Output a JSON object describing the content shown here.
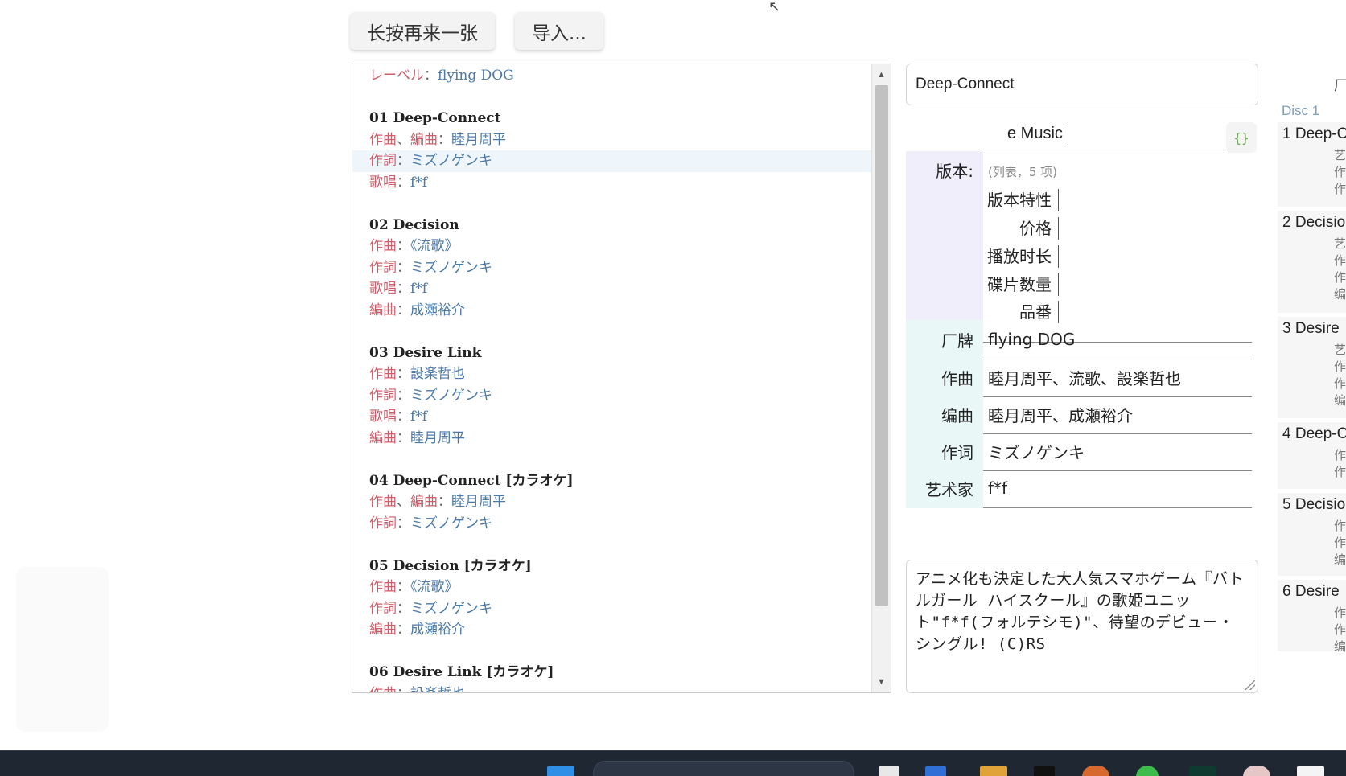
{
  "toolbar": {
    "next_label": "长按再来一张",
    "import_label": "导入..."
  },
  "lyrics": [
    {
      "type": "kv",
      "keys": [
        "レーベル"
      ],
      "value": "flying DOG"
    },
    {
      "type": "blank"
    },
    {
      "type": "title",
      "text": "01 Deep-Connect"
    },
    {
      "type": "kv",
      "keys": [
        "作曲",
        "編曲"
      ],
      "value": "睦月周平"
    },
    {
      "type": "kv",
      "keys": [
        "作詞"
      ],
      "value": "ミズノゲンキ",
      "highlight": true
    },
    {
      "type": "kv",
      "keys": [
        "歌唱"
      ],
      "value": "f*f"
    },
    {
      "type": "blank"
    },
    {
      "type": "title",
      "text": "02 Decision"
    },
    {
      "type": "kv",
      "keys": [
        "作曲"
      ],
      "value": "《流歌》"
    },
    {
      "type": "kv",
      "keys": [
        "作詞"
      ],
      "value": "ミズノゲンキ"
    },
    {
      "type": "kv",
      "keys": [
        "歌唱"
      ],
      "value": "f*f"
    },
    {
      "type": "kv",
      "keys": [
        "編曲"
      ],
      "value": "成瀬裕介"
    },
    {
      "type": "blank"
    },
    {
      "type": "title",
      "text": "03 Desire Link"
    },
    {
      "type": "kv",
      "keys": [
        "作曲"
      ],
      "value": "設楽哲也"
    },
    {
      "type": "kv",
      "keys": [
        "作詞"
      ],
      "value": "ミズノゲンキ"
    },
    {
      "type": "kv",
      "keys": [
        "歌唱"
      ],
      "value": "f*f"
    },
    {
      "type": "kv",
      "keys": [
        "編曲"
      ],
      "value": "睦月周平"
    },
    {
      "type": "blank"
    },
    {
      "type": "title",
      "text": "04 Deep-Connect [カラオケ]"
    },
    {
      "type": "kv",
      "keys": [
        "作曲",
        "編曲"
      ],
      "value": "睦月周平"
    },
    {
      "type": "kv",
      "keys": [
        "作詞"
      ],
      "value": "ミズノゲンキ"
    },
    {
      "type": "blank"
    },
    {
      "type": "title",
      "text": "05 Decision [カラオケ]"
    },
    {
      "type": "kv",
      "keys": [
        "作曲"
      ],
      "value": "《流歌》"
    },
    {
      "type": "kv",
      "keys": [
        "作詞"
      ],
      "value": "ミズノゲンキ"
    },
    {
      "type": "kv",
      "keys": [
        "編曲"
      ],
      "value": "成瀬裕介"
    },
    {
      "type": "blank"
    },
    {
      "type": "title",
      "text": "06 Desire Link [カラオケ]"
    },
    {
      "type": "kv",
      "keys": [
        "作曲"
      ],
      "value": "設楽哲也"
    }
  ],
  "form": {
    "title_value": "Deep-Connect",
    "music_value": "e Music",
    "json_button": "{}",
    "edition": {
      "label": "版本:",
      "summary": "(列表，5 项)",
      "items": [
        "版本特性",
        "价格",
        "播放时长",
        "碟片数量",
        "品番"
      ]
    },
    "fields": [
      {
        "label": "厂牌",
        "value": "flying DOG"
      },
      {
        "label": "作曲",
        "value": "睦月周平、流歌、設楽哲也"
      },
      {
        "label": "编曲",
        "value": "睦月周平、成瀬裕介"
      },
      {
        "label": "作词",
        "value": "ミズノゲンキ"
      },
      {
        "label": "艺术家",
        "value": "f*f"
      }
    ],
    "description": "アニメ化も決定した大人気スマホゲーム『バトルガール ハイスクール』の歌姫ユニット\"f*f(フォルテシモ)\"、待望のデビュー・シングル! (C)RS"
  },
  "right_panel": {
    "top_label": "厂",
    "disc_label": "Disc 1",
    "tracks": [
      {
        "title": "1 Deep-C",
        "subs": [
          "艺",
          "作",
          "作"
        ]
      },
      {
        "title": "2 Decisio",
        "subs": [
          "艺",
          "作",
          "作",
          "编"
        ]
      },
      {
        "title": "3 Desire",
        "subs": [
          "艺",
          "作",
          "作",
          "编"
        ]
      },
      {
        "title": "4 Deep-C",
        "subs": [
          "作",
          "作"
        ]
      },
      {
        "title": "5 Decisio",
        "subs": [
          "作",
          "作",
          "编"
        ]
      },
      {
        "title": "6 Desire",
        "subs": [
          "作",
          "作",
          "编"
        ]
      }
    ]
  },
  "colors": {
    "key": "#cf5d6a",
    "value": "#4b79a8",
    "edition_bg": "#f1eefc",
    "field_label_bg": "#e9f8f7",
    "json_icon": "#6aa84f",
    "taskbar": "#1f2733"
  }
}
